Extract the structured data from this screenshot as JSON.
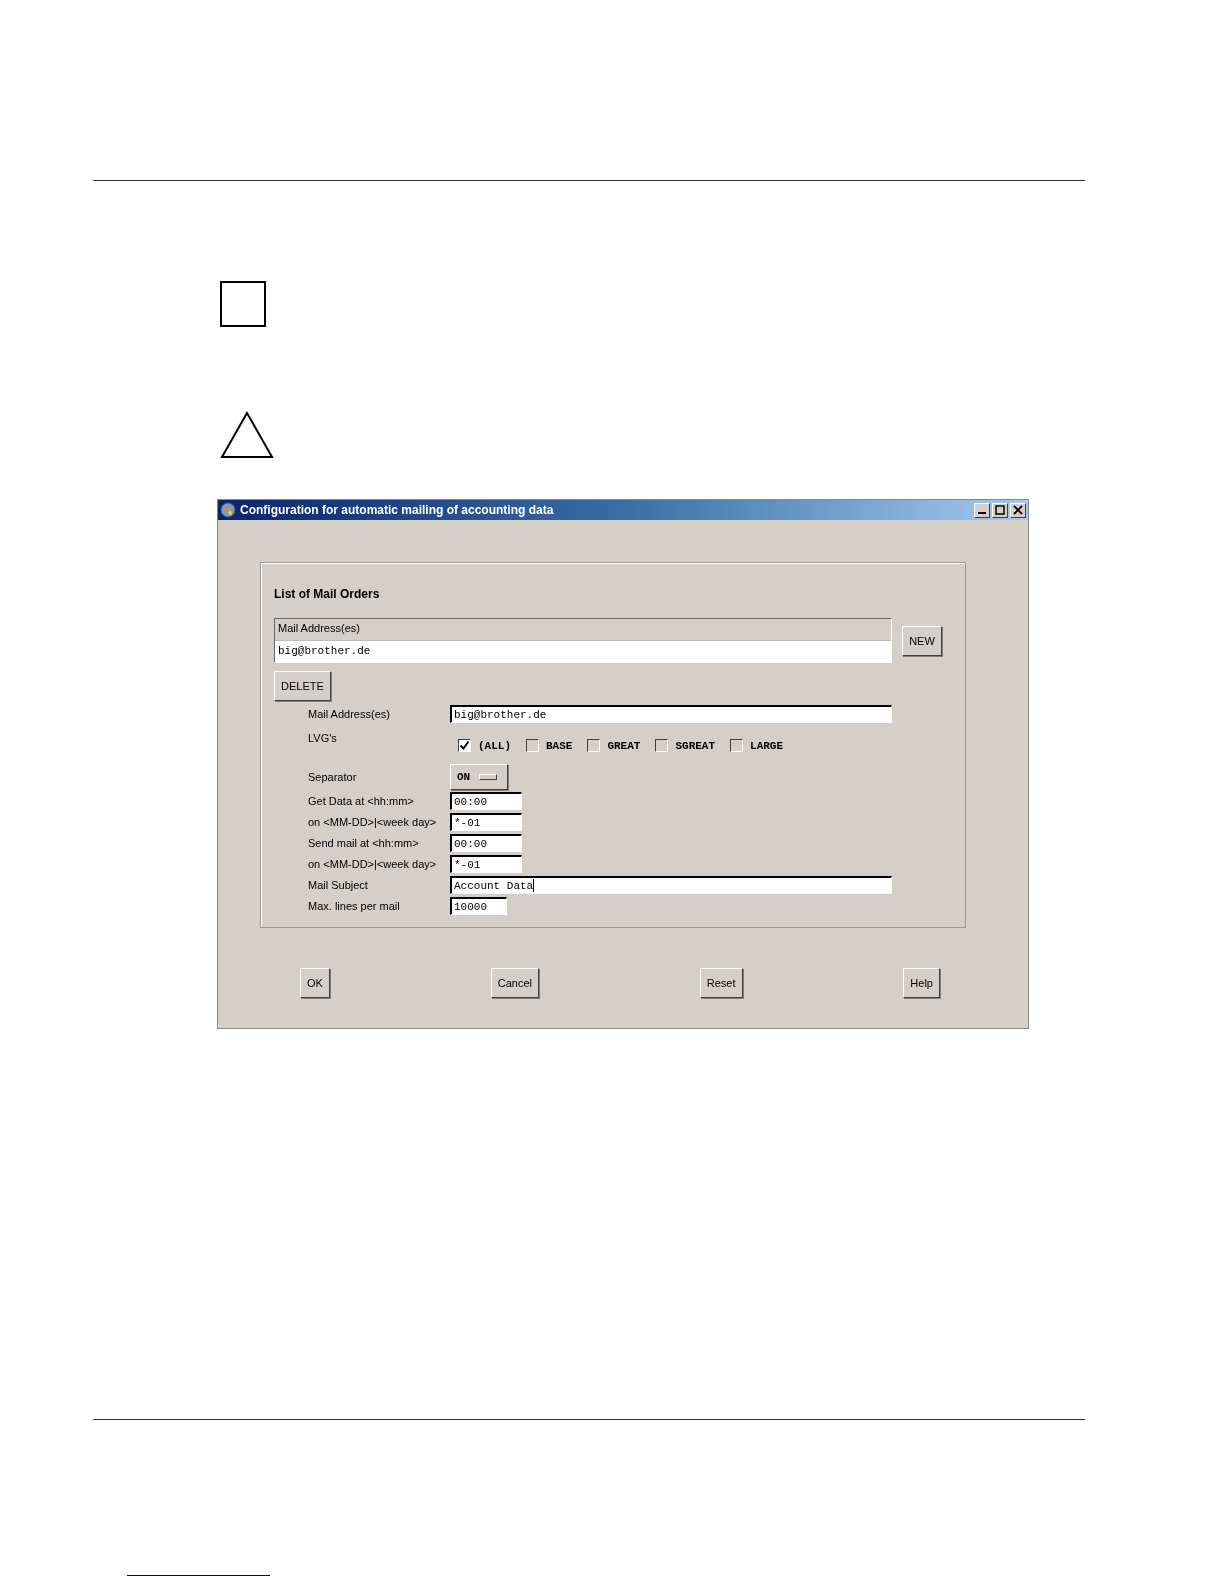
{
  "window": {
    "title": "Configuration for automatic mailing of accounting data"
  },
  "mail_orders": {
    "heading": "List of Mail Orders",
    "column": "Mail Address(es)",
    "rows": [
      {
        "text": "big@brother.de"
      }
    ],
    "new_button": "NEW",
    "delete_button": "DELETE"
  },
  "form": [
    {
      "kind": "text",
      "label": "Mail Address(es)",
      "value": "big@brother.de",
      "focused": false
    },
    {
      "kind": "checkboxes",
      "label": "LVG's",
      "options": [
        {
          "label": "(ALL)",
          "checked": true
        },
        {
          "label": "BASE",
          "checked": false
        },
        {
          "label": "GREAT",
          "checked": false
        },
        {
          "label": "SGREAT",
          "checked": false
        },
        {
          "label": "LARGE",
          "checked": false
        }
      ]
    },
    {
      "kind": "toggle",
      "label": "Separator",
      "value": "ON"
    },
    {
      "kind": "time",
      "label": "Get Data at <hh:mm>",
      "value": "00:00",
      "focused": false
    },
    {
      "kind": "time",
      "label": "on <MM-DD>|<week day>",
      "value": "*-01",
      "focused": false
    },
    {
      "kind": "time",
      "label": "Send mail at <hh:mm>",
      "value": "00:00",
      "focused": false
    },
    {
      "kind": "time",
      "label": "on <MM-DD>|<week day>",
      "value": "*-01",
      "focused": false
    },
    {
      "kind": "text",
      "label": "Mail Subject",
      "value": "Account Data",
      "focused": true
    },
    {
      "kind": "number",
      "label": "Max. lines per mail",
      "value": "10000",
      "focused": false
    }
  ],
  "buttons": [
    "OK",
    "Cancel",
    "Reset",
    "Help"
  ]
}
